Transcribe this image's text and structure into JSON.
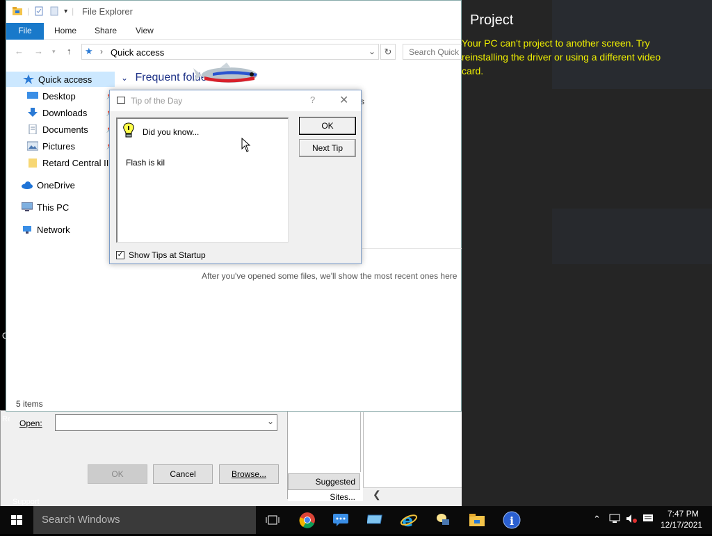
{
  "explorer": {
    "title": "File Explorer",
    "tabs": {
      "file": "File",
      "home": "Home",
      "share": "Share",
      "view": "View"
    },
    "address": {
      "path": "Quick access",
      "search_placeholder": "Search Quick"
    },
    "nav": {
      "quick_access": "Quick access",
      "desktop": "Desktop",
      "downloads": "Downloads",
      "documents": "Documents",
      "pictures": "Pictures",
      "retard": "Retard Central II",
      "onedrive": "OneDrive",
      "this_pc": "This PC",
      "network": "Network"
    },
    "frequent_folders": "Frequent folders",
    "stray_s": "s",
    "recent_message": "After you've opened some files, we'll show the most recent ones here",
    "status": "5 items"
  },
  "tip_dialog": {
    "title": "Tip of the Day",
    "help": "?",
    "close": "✕",
    "did_you_know": "Did you know...",
    "tip_text": "Flash is kil",
    "ok": "OK",
    "next_tip": "Next Tip",
    "show_tips": "Show Tips at Startup",
    "show_tips_checked": true
  },
  "run_dialog": {
    "open_label": "Open:",
    "open_value": "",
    "ok": "OK",
    "cancel": "Cancel",
    "browse": "Browse..."
  },
  "background": {
    "suggested_sites": "Suggested Sites...",
    "support": "Support",
    "re": "Re",
    "c": "C"
  },
  "project": {
    "title": "Project",
    "message": "Your PC can't project to another screen. Try reinstalling the driver or using a different video card."
  },
  "taskbar": {
    "search_placeholder": "Search Windows",
    "time": "7:47 PM",
    "date": "12/17/2021"
  },
  "colors": {
    "accent": "#1979ca",
    "project_text": "#f0f000",
    "taskbar": "#0a0a0a"
  }
}
